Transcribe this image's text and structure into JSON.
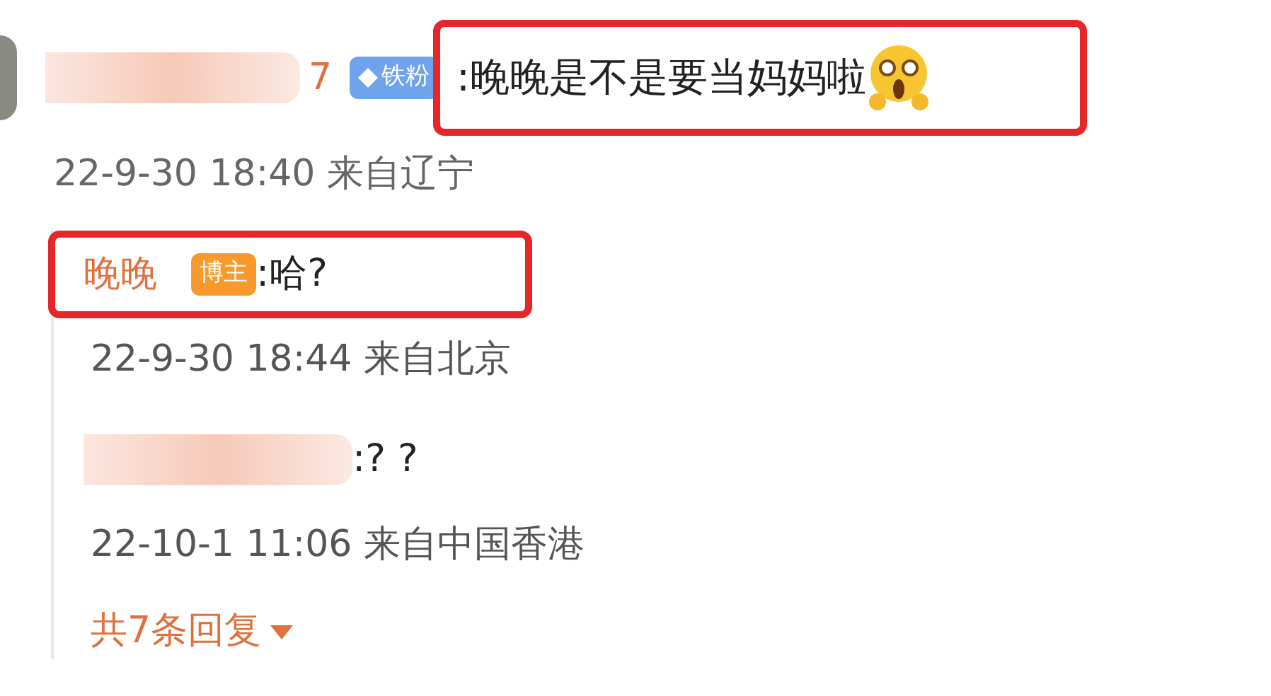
{
  "comment": {
    "author_tail": "7",
    "badge": "铁粉",
    "text": ":晚晚是不是要当妈妈啦",
    "highlighted": true,
    "time": "22-9-30 18:40 来自辽宁"
  },
  "replies": [
    {
      "kind": "named",
      "author": "晚晚",
      "badge": "博主",
      "text": ":哈?",
      "highlighted": true,
      "time": "22-9-30 18:44 来自北京"
    },
    {
      "kind": "blurred",
      "text": ":? ?",
      "time": "22-10-1 11:06 来自中国香港"
    }
  ],
  "more_replies": "共7条回复"
}
